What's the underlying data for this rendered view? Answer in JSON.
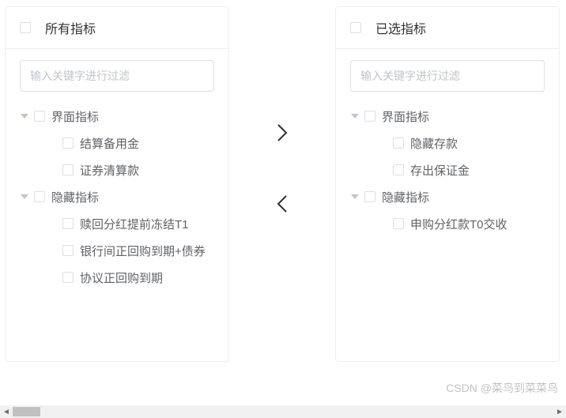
{
  "left_panel": {
    "title": "所有指标",
    "filter_placeholder": "输入关键字进行过滤",
    "groups": [
      {
        "label": "界面指标",
        "children": [
          {
            "label": "结算备用金"
          },
          {
            "label": "证券清算款"
          }
        ]
      },
      {
        "label": "隐藏指标",
        "children": [
          {
            "label": "赎回分红提前冻结T1"
          },
          {
            "label": "银行间正回购到期+债券"
          },
          {
            "label": "协议正回购到期"
          }
        ]
      }
    ]
  },
  "right_panel": {
    "title": "已选指标",
    "filter_placeholder": "输入关键字进行过滤",
    "groups": [
      {
        "label": "界面指标",
        "children": [
          {
            "label": "隐藏存款"
          },
          {
            "label": "存出保证金"
          }
        ]
      },
      {
        "label": "隐藏指标",
        "children": [
          {
            "label": "申购分红款T0交收"
          }
        ]
      }
    ]
  },
  "watermark": "CSDN @菜鸟到菜菜鸟"
}
